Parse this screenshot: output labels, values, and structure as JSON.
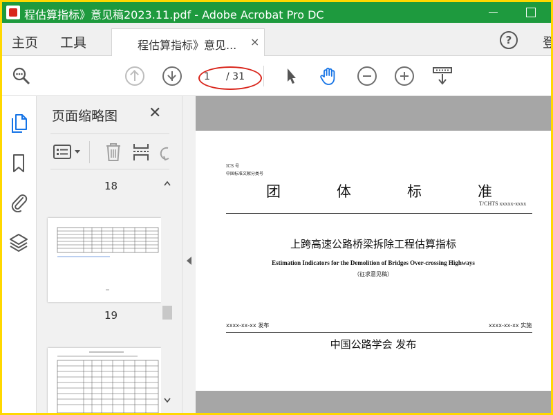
{
  "window": {
    "title": "程估算指标》意见稿2023.11.pdf - Adobe Acrobat Pro DC"
  },
  "tabs": {
    "home": "主页",
    "tools": "工具",
    "document": "程估算指标》意见...",
    "close": "×",
    "help": "?",
    "login_partial": "登"
  },
  "toolbar": {
    "page_current": "1",
    "page_total": "/ 31"
  },
  "thumbnails": {
    "title": "页面缩略图",
    "close": "✕",
    "labels": [
      "18",
      "19"
    ],
    "collapsed_page_dash": "-"
  },
  "document": {
    "ics": "ICS 号",
    "classification": "中国标准文献分类号",
    "standard_chars": [
      "团",
      "体",
      "标",
      "准"
    ],
    "code": "T/CHTS xxxxx-xxxx",
    "title_cn": "上跨高速公路桥梁拆除工程估算指标",
    "title_en": "Estimation Indicators for the Demolition of Bridges Over-crossing Highways",
    "draft_note": "（征求意见稿）",
    "publish_date": "xxxx-xx-xx 发布",
    "implement_date": "xxxx-xx-xx 实施",
    "publisher": "中国公路学会  发布"
  },
  "colors": {
    "titlebar": "#1e9a3e",
    "frame": "#ffd800",
    "accent": "#1473e6",
    "annotation": "#d9261c"
  }
}
